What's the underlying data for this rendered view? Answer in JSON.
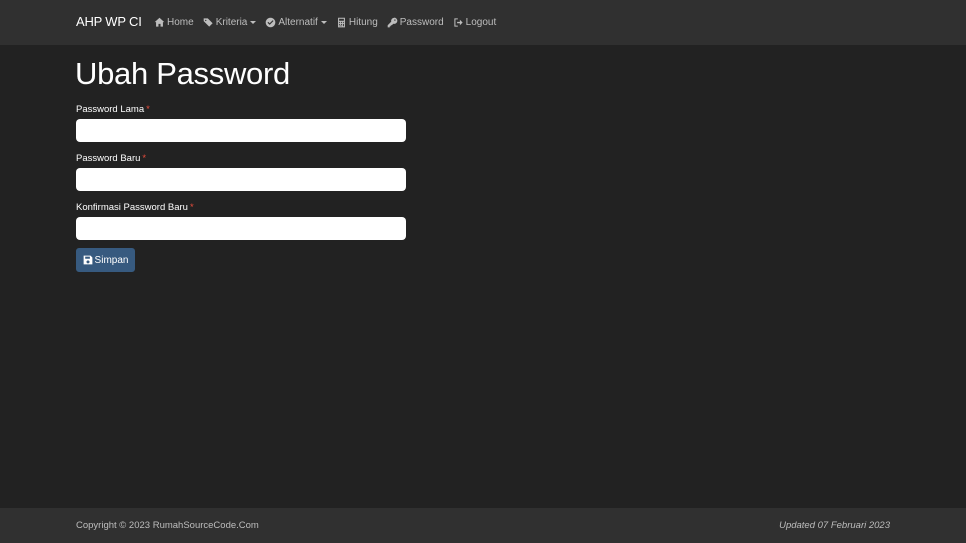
{
  "navbar": {
    "brand": "AHP WP CI",
    "items": [
      {
        "label": "Home",
        "icon": "home-icon"
      },
      {
        "label": "Kriteria",
        "icon": "tags-icon"
      },
      {
        "label": "Alternatif",
        "icon": "check-circle-icon"
      },
      {
        "label": "Hitung",
        "icon": "calculator-icon"
      },
      {
        "label": "Password",
        "icon": "key-icon"
      },
      {
        "label": "Logout",
        "icon": "sign-out-icon"
      }
    ]
  },
  "page": {
    "title": "Ubah Password"
  },
  "form": {
    "old_password": {
      "label": "Password Lama",
      "required": "*",
      "value": ""
    },
    "new_password": {
      "label": "Password Baru",
      "required": "*",
      "value": ""
    },
    "confirm_password": {
      "label": "Konfirmasi Password Baru",
      "required": "*",
      "value": ""
    },
    "submit_label": "Simpan"
  },
  "footer": {
    "copyright": "Copyright © 2023 RumahSourceCode.Com",
    "updated": "Updated 07 Februari 2023"
  },
  "colors": {
    "background": "#222222",
    "navbar": "#303030",
    "primary": "#375a7f",
    "required": "#e74c3c"
  }
}
